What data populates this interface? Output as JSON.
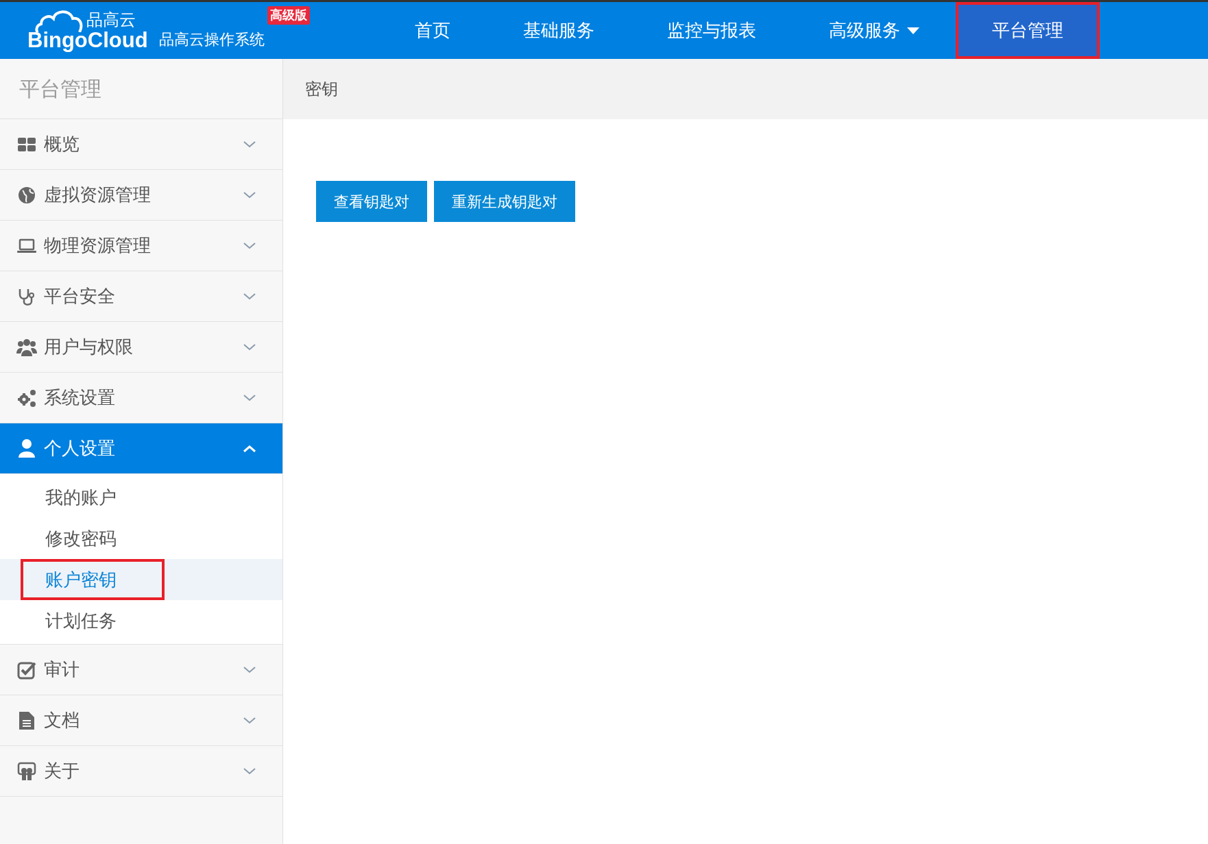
{
  "header": {
    "logo_cn": "品高云",
    "logo_en": "BingoCloud",
    "system_name": "品高云操作系统",
    "edition_badge": "高级版"
  },
  "nav": [
    {
      "label": "首页",
      "selected": false,
      "dropdown": false,
      "annotated": false
    },
    {
      "label": "基础服务",
      "selected": false,
      "dropdown": false,
      "annotated": false
    },
    {
      "label": "监控与报表",
      "selected": false,
      "dropdown": false,
      "annotated": false
    },
    {
      "label": "高级服务",
      "selected": false,
      "dropdown": true,
      "annotated": false
    },
    {
      "label": "平台管理",
      "selected": true,
      "dropdown": false,
      "annotated": true
    }
  ],
  "sidebar": {
    "title": "平台管理",
    "groups": [
      {
        "label": "概览",
        "expanded": false
      },
      {
        "label": "虚拟资源管理",
        "expanded": false
      },
      {
        "label": "物理资源管理",
        "expanded": false
      },
      {
        "label": "平台安全",
        "expanded": false
      },
      {
        "label": "用户与权限",
        "expanded": false
      },
      {
        "label": "系统设置",
        "expanded": false
      },
      {
        "label": "个人设置",
        "expanded": true,
        "children": [
          {
            "label": "我的账户",
            "selected": false,
            "annotated": false
          },
          {
            "label": "修改密码",
            "selected": false,
            "annotated": false
          },
          {
            "label": "账户密钥",
            "selected": true,
            "annotated": true
          },
          {
            "label": "计划任务",
            "selected": false,
            "annotated": false
          }
        ]
      },
      {
        "label": "审计",
        "expanded": false
      },
      {
        "label": "文档",
        "expanded": false
      },
      {
        "label": "关于",
        "expanded": false
      }
    ]
  },
  "breadcrumb": "密钥",
  "buttons": [
    "查看钥匙对",
    "重新生成钥匙对"
  ]
}
